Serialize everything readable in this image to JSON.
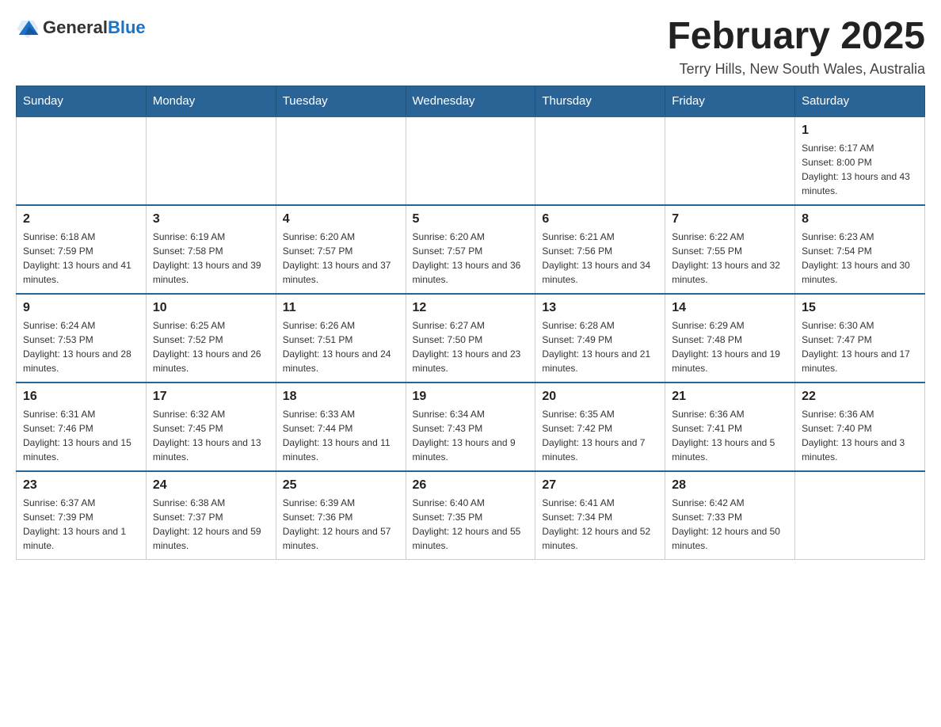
{
  "header": {
    "logo_general": "General",
    "logo_blue": "Blue",
    "month_title": "February 2025",
    "location": "Terry Hills, New South Wales, Australia"
  },
  "days_of_week": [
    "Sunday",
    "Monday",
    "Tuesday",
    "Wednesday",
    "Thursday",
    "Friday",
    "Saturday"
  ],
  "weeks": [
    [
      {
        "day": "",
        "sunrise": "",
        "sunset": "",
        "daylight": ""
      },
      {
        "day": "",
        "sunrise": "",
        "sunset": "",
        "daylight": ""
      },
      {
        "day": "",
        "sunrise": "",
        "sunset": "",
        "daylight": ""
      },
      {
        "day": "",
        "sunrise": "",
        "sunset": "",
        "daylight": ""
      },
      {
        "day": "",
        "sunrise": "",
        "sunset": "",
        "daylight": ""
      },
      {
        "day": "",
        "sunrise": "",
        "sunset": "",
        "daylight": ""
      },
      {
        "day": "1",
        "sunrise": "Sunrise: 6:17 AM",
        "sunset": "Sunset: 8:00 PM",
        "daylight": "Daylight: 13 hours and 43 minutes."
      }
    ],
    [
      {
        "day": "2",
        "sunrise": "Sunrise: 6:18 AM",
        "sunset": "Sunset: 7:59 PM",
        "daylight": "Daylight: 13 hours and 41 minutes."
      },
      {
        "day": "3",
        "sunrise": "Sunrise: 6:19 AM",
        "sunset": "Sunset: 7:58 PM",
        "daylight": "Daylight: 13 hours and 39 minutes."
      },
      {
        "day": "4",
        "sunrise": "Sunrise: 6:20 AM",
        "sunset": "Sunset: 7:57 PM",
        "daylight": "Daylight: 13 hours and 37 minutes."
      },
      {
        "day": "5",
        "sunrise": "Sunrise: 6:20 AM",
        "sunset": "Sunset: 7:57 PM",
        "daylight": "Daylight: 13 hours and 36 minutes."
      },
      {
        "day": "6",
        "sunrise": "Sunrise: 6:21 AM",
        "sunset": "Sunset: 7:56 PM",
        "daylight": "Daylight: 13 hours and 34 minutes."
      },
      {
        "day": "7",
        "sunrise": "Sunrise: 6:22 AM",
        "sunset": "Sunset: 7:55 PM",
        "daylight": "Daylight: 13 hours and 32 minutes."
      },
      {
        "day": "8",
        "sunrise": "Sunrise: 6:23 AM",
        "sunset": "Sunset: 7:54 PM",
        "daylight": "Daylight: 13 hours and 30 minutes."
      }
    ],
    [
      {
        "day": "9",
        "sunrise": "Sunrise: 6:24 AM",
        "sunset": "Sunset: 7:53 PM",
        "daylight": "Daylight: 13 hours and 28 minutes."
      },
      {
        "day": "10",
        "sunrise": "Sunrise: 6:25 AM",
        "sunset": "Sunset: 7:52 PM",
        "daylight": "Daylight: 13 hours and 26 minutes."
      },
      {
        "day": "11",
        "sunrise": "Sunrise: 6:26 AM",
        "sunset": "Sunset: 7:51 PM",
        "daylight": "Daylight: 13 hours and 24 minutes."
      },
      {
        "day": "12",
        "sunrise": "Sunrise: 6:27 AM",
        "sunset": "Sunset: 7:50 PM",
        "daylight": "Daylight: 13 hours and 23 minutes."
      },
      {
        "day": "13",
        "sunrise": "Sunrise: 6:28 AM",
        "sunset": "Sunset: 7:49 PM",
        "daylight": "Daylight: 13 hours and 21 minutes."
      },
      {
        "day": "14",
        "sunrise": "Sunrise: 6:29 AM",
        "sunset": "Sunset: 7:48 PM",
        "daylight": "Daylight: 13 hours and 19 minutes."
      },
      {
        "day": "15",
        "sunrise": "Sunrise: 6:30 AM",
        "sunset": "Sunset: 7:47 PM",
        "daylight": "Daylight: 13 hours and 17 minutes."
      }
    ],
    [
      {
        "day": "16",
        "sunrise": "Sunrise: 6:31 AM",
        "sunset": "Sunset: 7:46 PM",
        "daylight": "Daylight: 13 hours and 15 minutes."
      },
      {
        "day": "17",
        "sunrise": "Sunrise: 6:32 AM",
        "sunset": "Sunset: 7:45 PM",
        "daylight": "Daylight: 13 hours and 13 minutes."
      },
      {
        "day": "18",
        "sunrise": "Sunrise: 6:33 AM",
        "sunset": "Sunset: 7:44 PM",
        "daylight": "Daylight: 13 hours and 11 minutes."
      },
      {
        "day": "19",
        "sunrise": "Sunrise: 6:34 AM",
        "sunset": "Sunset: 7:43 PM",
        "daylight": "Daylight: 13 hours and 9 minutes."
      },
      {
        "day": "20",
        "sunrise": "Sunrise: 6:35 AM",
        "sunset": "Sunset: 7:42 PM",
        "daylight": "Daylight: 13 hours and 7 minutes."
      },
      {
        "day": "21",
        "sunrise": "Sunrise: 6:36 AM",
        "sunset": "Sunset: 7:41 PM",
        "daylight": "Daylight: 13 hours and 5 minutes."
      },
      {
        "day": "22",
        "sunrise": "Sunrise: 6:36 AM",
        "sunset": "Sunset: 7:40 PM",
        "daylight": "Daylight: 13 hours and 3 minutes."
      }
    ],
    [
      {
        "day": "23",
        "sunrise": "Sunrise: 6:37 AM",
        "sunset": "Sunset: 7:39 PM",
        "daylight": "Daylight: 13 hours and 1 minute."
      },
      {
        "day": "24",
        "sunrise": "Sunrise: 6:38 AM",
        "sunset": "Sunset: 7:37 PM",
        "daylight": "Daylight: 12 hours and 59 minutes."
      },
      {
        "day": "25",
        "sunrise": "Sunrise: 6:39 AM",
        "sunset": "Sunset: 7:36 PM",
        "daylight": "Daylight: 12 hours and 57 minutes."
      },
      {
        "day": "26",
        "sunrise": "Sunrise: 6:40 AM",
        "sunset": "Sunset: 7:35 PM",
        "daylight": "Daylight: 12 hours and 55 minutes."
      },
      {
        "day": "27",
        "sunrise": "Sunrise: 6:41 AM",
        "sunset": "Sunset: 7:34 PM",
        "daylight": "Daylight: 12 hours and 52 minutes."
      },
      {
        "day": "28",
        "sunrise": "Sunrise: 6:42 AM",
        "sunset": "Sunset: 7:33 PM",
        "daylight": "Daylight: 12 hours and 50 minutes."
      },
      {
        "day": "",
        "sunrise": "",
        "sunset": "",
        "daylight": ""
      }
    ]
  ]
}
